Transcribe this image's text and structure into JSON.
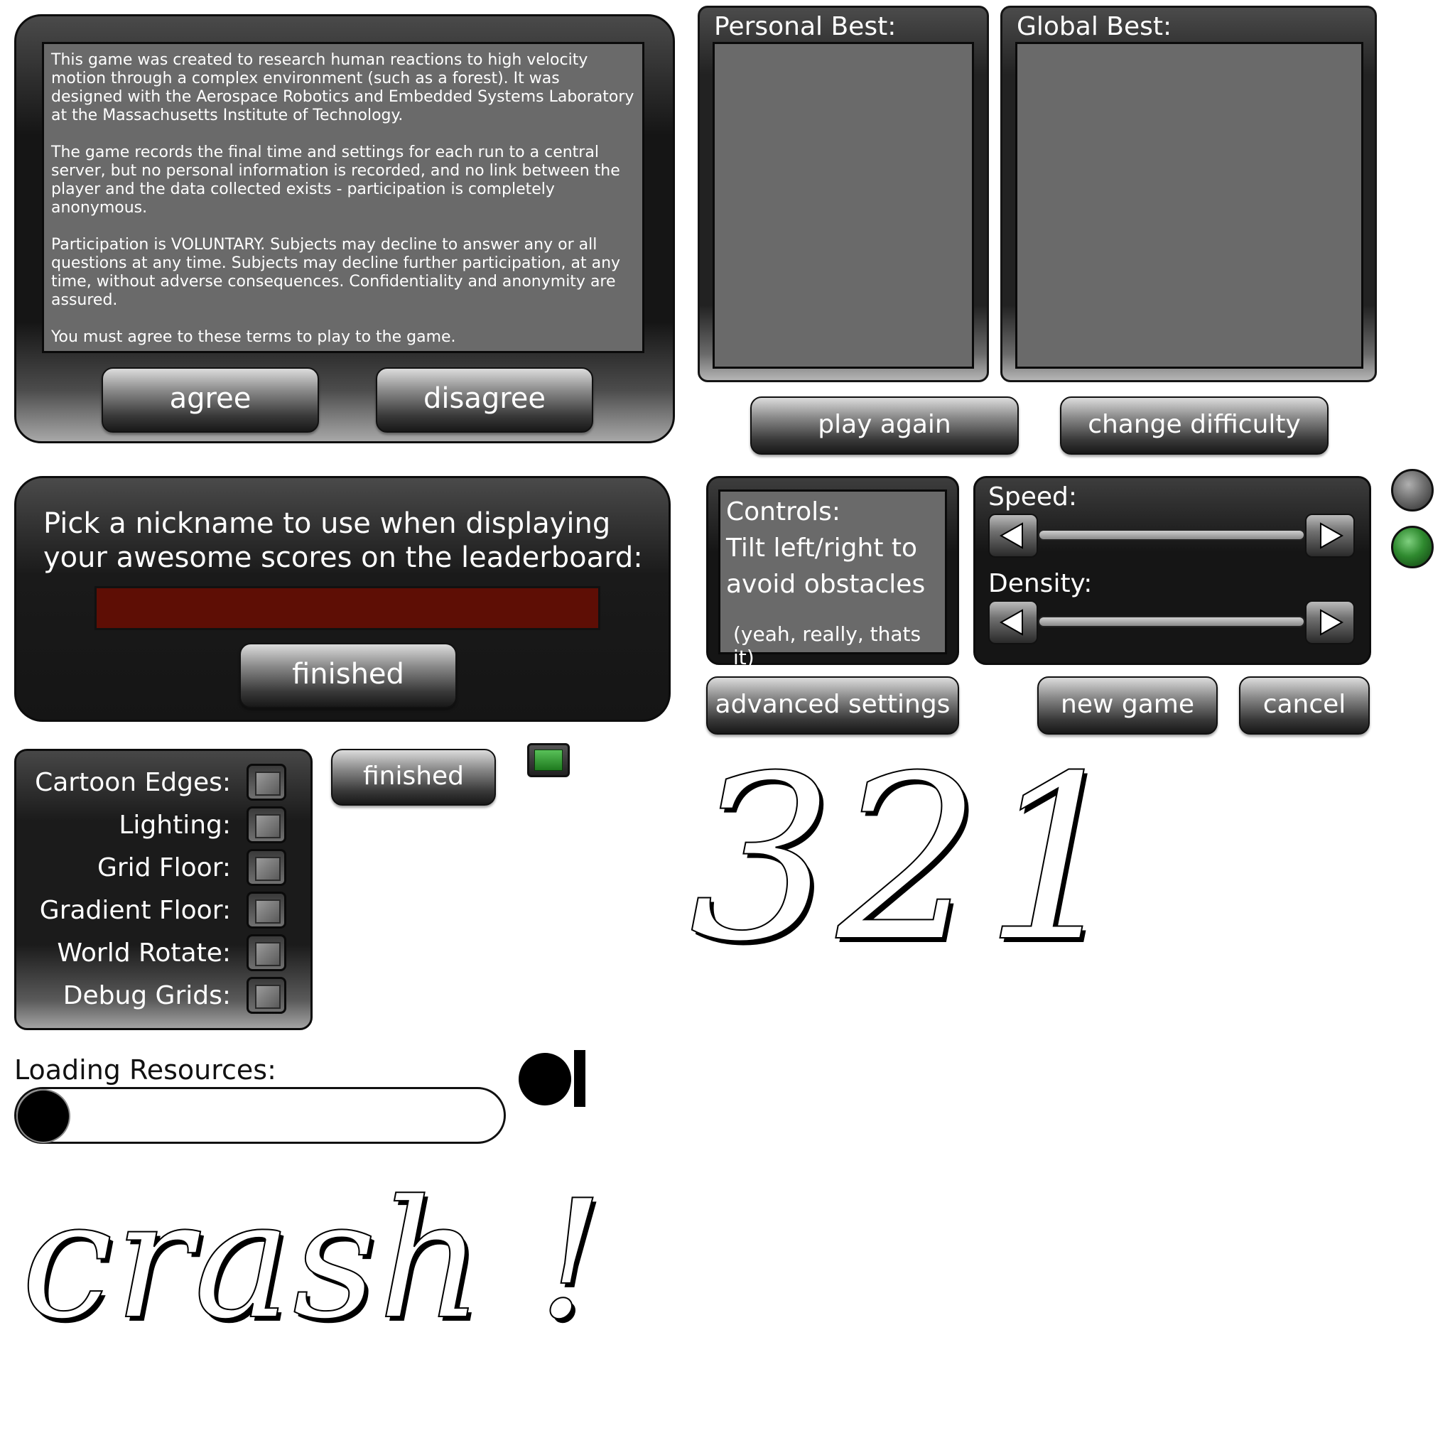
{
  "consent": {
    "paragraphs": [
      "This game was created to research human reactions to high velocity motion through a complex environment (such as a forest).  It was designed with the Aerospace Robotics and Embedded Systems Laboratory at the Massachusetts Institute of Technology.",
      "The game records the final time and settings for each run to a central server, but no personal information is recorded, and no link between the player and the data collected exists - participation is completely anonymous.",
      "Participation is VOLUNTARY.  Subjects may decline to answer any or all questions at any time.  Subjects may decline further participation, at any time, without adverse consequences.  Confidentiality and anonymity are assured.",
      "You must agree to these terms to play to the game."
    ],
    "agree_label": "agree",
    "disagree_label": "disagree"
  },
  "scores": {
    "personal_title": "Personal Best:",
    "global_title": "Global Best:",
    "play_again_label": "play again",
    "change_difficulty_label": "change difficulty"
  },
  "nickname": {
    "prompt_line1": "Pick a nickname to use when displaying",
    "prompt_line2": "your awesome scores on the leaderboard:",
    "input_value": "",
    "finished_label": "finished"
  },
  "controls": {
    "title": "Controls:",
    "line1": "Tilt left/right to",
    "line2": "avoid obstacles",
    "note": "(yeah, really, thats it)"
  },
  "settings": {
    "speed_label": "Speed:",
    "density_label": "Density:",
    "advanced_label": "advanced settings",
    "new_game_label": "new game",
    "cancel_label": "cancel"
  },
  "advanced": {
    "options": [
      "Cartoon Edges:",
      "Lighting:",
      "Grid Floor:",
      "Gradient Floor:",
      "World Rotate:",
      "Debug Grids:"
    ],
    "finished_label": "finished"
  },
  "countdown": {
    "text": "321"
  },
  "loading": {
    "label": "Loading Resources:"
  },
  "crash": {
    "text": "crash !"
  },
  "colors": {
    "nickname_field": "#5e0e05",
    "led_green": "#2f8a2f",
    "led_grey": "#707070"
  }
}
